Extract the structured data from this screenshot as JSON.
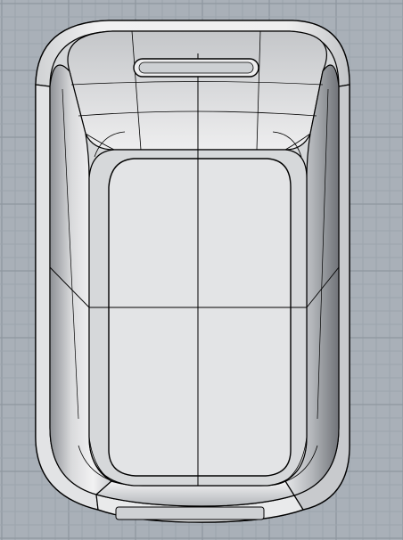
{
  "viewport": {
    "background": "#a9b0b8",
    "grid_minor_color": "#9ca4ad",
    "grid_major_color": "#8e969f",
    "grid_minor_step": 15,
    "grid_major_every": 5
  },
  "model": {
    "name_icon": "rounded-tray-with-slot-handle",
    "shaded_surface_color": "#e7e8e9",
    "shadow_color": "#9da0a4",
    "edge_color": "#000000"
  }
}
